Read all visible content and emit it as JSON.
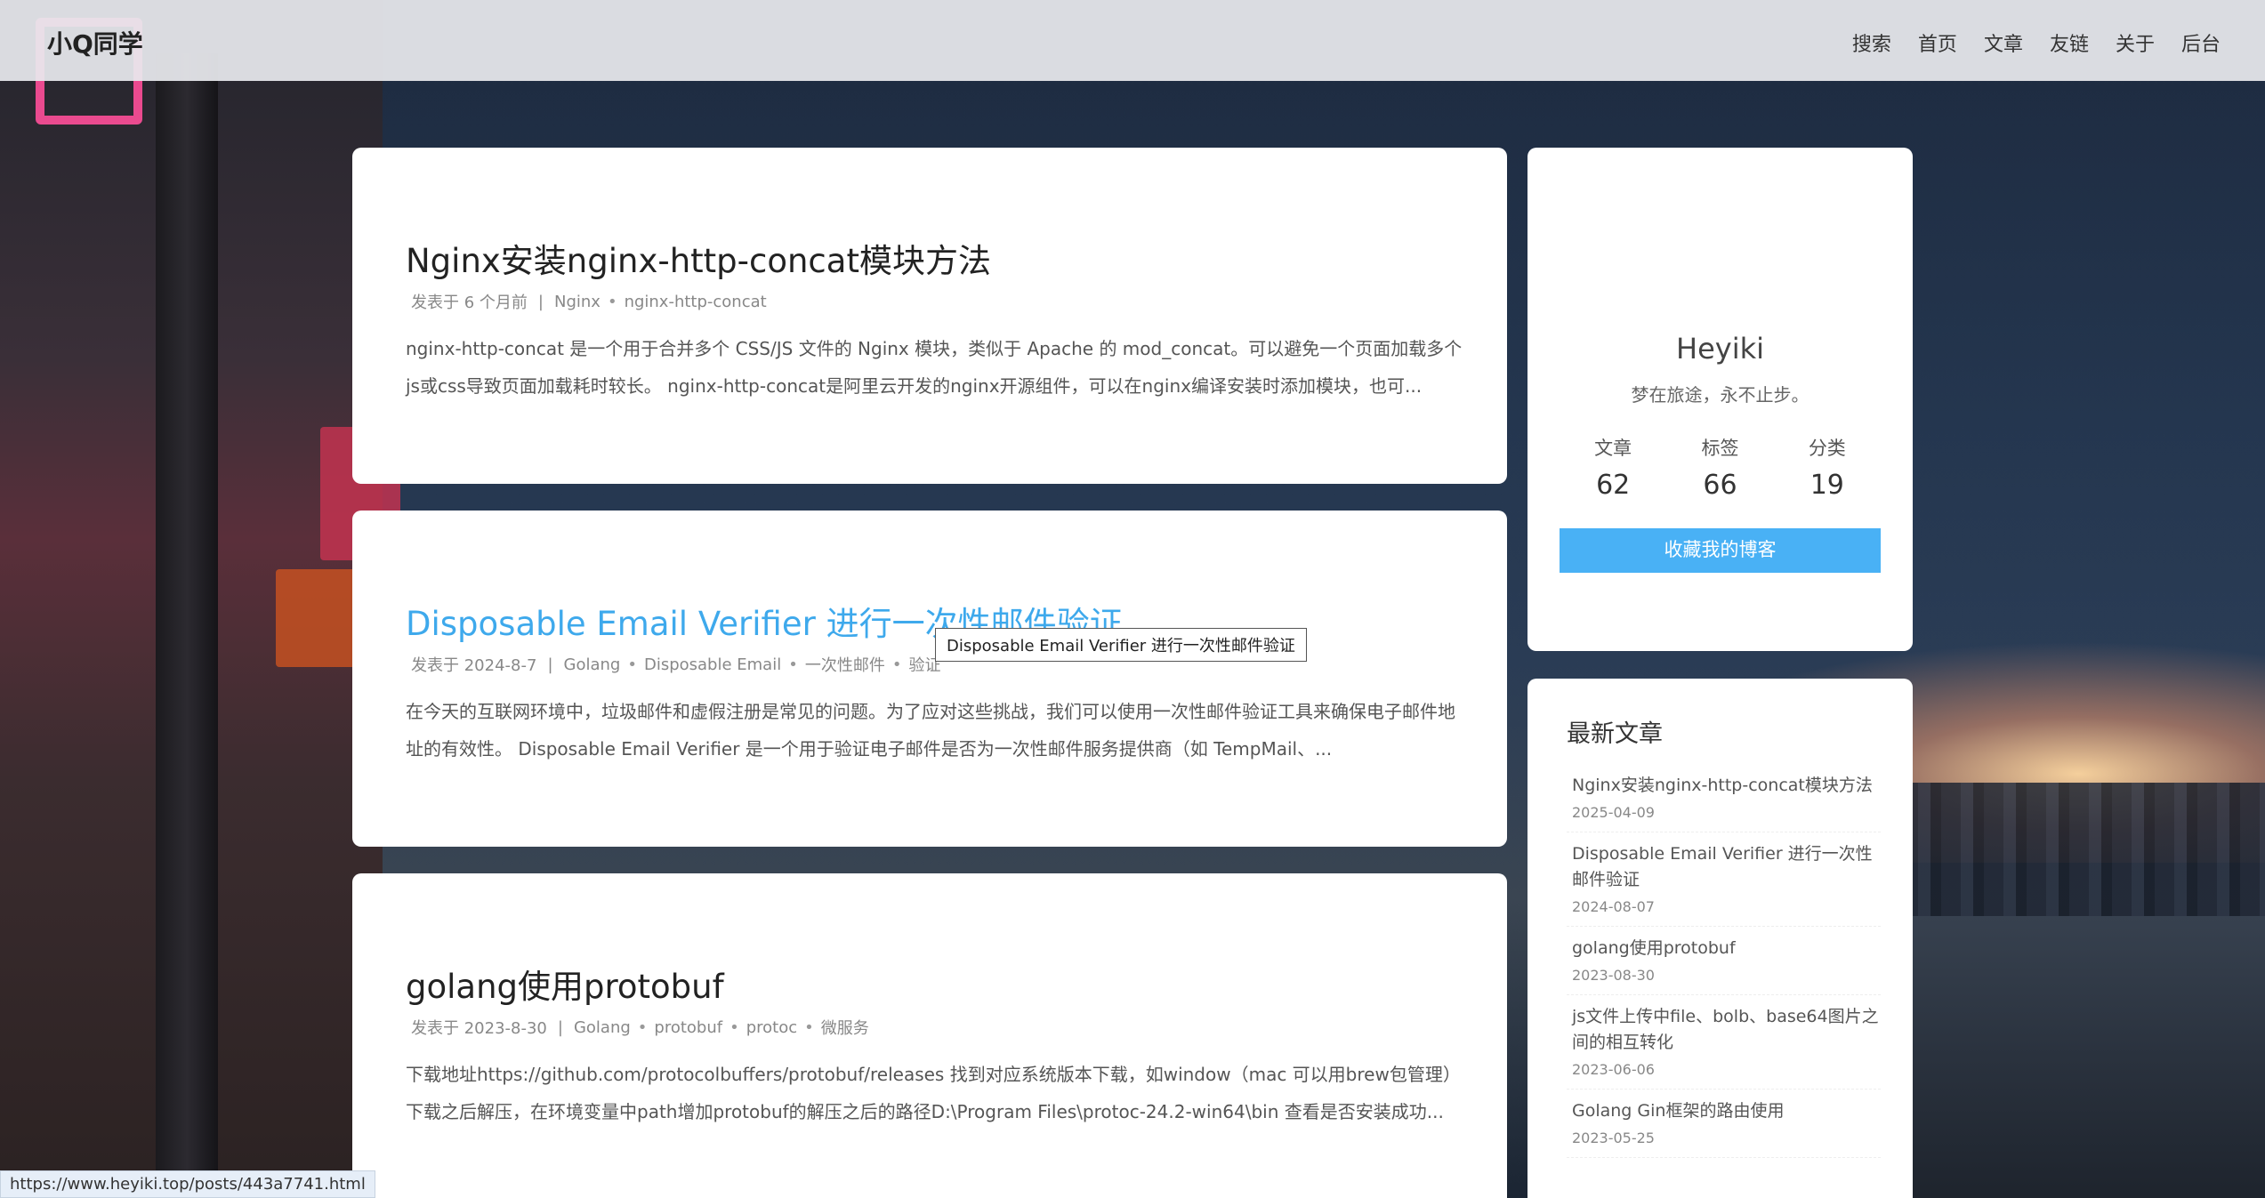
{
  "header": {
    "brand": "小Q同学",
    "nav": [
      "搜索",
      "首页",
      "文章",
      "友链",
      "关于",
      "后台"
    ]
  },
  "posts": [
    {
      "title": "Nginx安装nginx-http-concat模块方法",
      "meta_prefix": "发表于 6 个月前",
      "tags": [
        "Nginx",
        "nginx-http-concat"
      ],
      "excerpt": "nginx-http-concat 是一个用于合并多个 CSS/JS 文件的 Nginx 模块，类似于 Apache 的 mod_concat。可以避免一个页面加载多个js或css导致页面加载耗时较长。 nginx-http-concat是阿里云开发的nginx开源组件，可以在nginx编译安装时添加模块，也可..."
    },
    {
      "title": "Disposable Email Verifier 进行一次性邮件验证",
      "meta_prefix": "发表于 2024-8-7",
      "tags": [
        "Golang",
        "Disposable Email",
        "一次性邮件",
        "验证"
      ],
      "excerpt": "在今天的互联网环境中，垃圾邮件和虚假注册是常见的问题。为了应对这些挑战，我们可以使用一次性邮件验证工具来确保电子邮件地址的有效性。 Disposable Email Verifier 是一个用于验证电子邮件是否为一次性邮件服务提供商（如 TempMail、..."
    },
    {
      "title": "golang使用protobuf",
      "meta_prefix": "发表于 2023-8-30",
      "tags": [
        "Golang",
        "protobuf",
        "protoc",
        "微服务"
      ],
      "excerpt": "下载地址https://github.com/protocolbuffers/protobuf/releases 找到对应系统版本下载，如window（mac 可以用brew包管理）下载之后解压，在环境变量中path增加protobuf的解压之后的路径D:\\Program Files\\protoc-24.2-win64\\bin 查看是否安装成功..."
    }
  ],
  "tooltip": "Disposable Email Verifier 进行一次性邮件验证",
  "profile": {
    "name": "Heyiki",
    "motto": "梦在旅途，永不止步。",
    "stats": [
      {
        "label": "文章",
        "value": "62"
      },
      {
        "label": "标签",
        "value": "66"
      },
      {
        "label": "分类",
        "value": "19"
      }
    ],
    "fav_button": "收藏我的博客"
  },
  "recent": {
    "title": "最新文章",
    "items": [
      {
        "title": "Nginx安装nginx-http-concat模块方法",
        "date": "2025-04-09"
      },
      {
        "title": "Disposable Email Verifier 进行一次性邮件验证",
        "date": "2024-08-07"
      },
      {
        "title": "golang使用protobuf",
        "date": "2023-08-30"
      },
      {
        "title": "js文件上传中file、bolb、base64图片之间的相互转化",
        "date": "2023-06-06"
      },
      {
        "title": "Golang Gin框架的路由使用",
        "date": "2023-05-25"
      }
    ]
  },
  "status_url": "https://www.heyiki.top/posts/443a7741.html"
}
